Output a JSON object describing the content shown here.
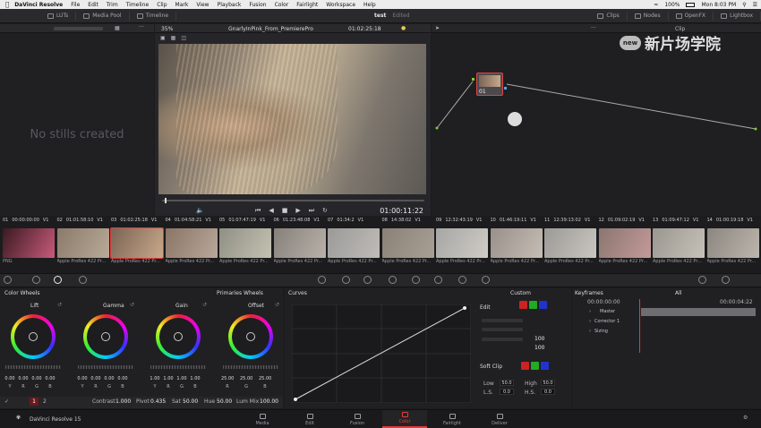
{
  "mac_menu": {
    "app": "DaVinci Resolve",
    "items": [
      "File",
      "Edit",
      "Trim",
      "Timeline",
      "Clip",
      "Mark",
      "View",
      "Playback",
      "Fusion",
      "Color",
      "Fairlight",
      "Workspace",
      "Help"
    ],
    "status": [
      "100%",
      "Mon 8:03 PM"
    ]
  },
  "topbar": {
    "luts": "LUTs",
    "media_pool": "Media Pool",
    "timeline": "Timeline",
    "project": "test",
    "edited": "Edited",
    "clips": "Clips",
    "nodes": "Nodes",
    "openfx": "OpenFX",
    "lightbox": "Lightbox"
  },
  "viewer": {
    "zoom": "35%",
    "clip_name": "GnarlyInPink_From_PremierePro",
    "source_tc": "01:02:25:18",
    "timecode": "01:00:11:22"
  },
  "gallery": {
    "empty_text": "No stills created"
  },
  "nodes": {
    "node_label": "01",
    "clip_header": "Clip"
  },
  "watermark": "新片场学院",
  "clips": [
    {
      "num": "01",
      "tc": "00:00:00:00",
      "track": "V1",
      "codec": "PNG",
      "c1": "#3a1a22",
      "c2": "#c85a7a"
    },
    {
      "num": "02",
      "tc": "01:01:58:10",
      "track": "V1",
      "codec": "Apple ProRes 422 Pr...",
      "c1": "#8a7a6a",
      "c2": "#b9aa98"
    },
    {
      "num": "03",
      "tc": "01:02:25:18",
      "track": "V1",
      "codec": "Apple ProRes 422 Pr...",
      "c1": "#7a6455",
      "c2": "#c8a88a"
    },
    {
      "num": "04",
      "tc": "01:04:58:21",
      "track": "V1",
      "codec": "Apple ProRes 422 Pr...",
      "c1": "#8a7466",
      "c2": "#b9a89a"
    },
    {
      "num": "05",
      "tc": "01:07:47:19",
      "track": "V1",
      "codec": "Apple ProRes 422 Pr...",
      "c1": "#8f8f84",
      "c2": "#c5c2b2"
    },
    {
      "num": "06",
      "tc": "01:23:48:08",
      "track": "V1",
      "codec": "Apple ProRes 422 Pr...",
      "c1": "#86807a",
      "c2": "#b8b2aa"
    },
    {
      "num": "07",
      "tc": "01:34:2",
      "track": "V1",
      "codec": "Apple ProRes 422 Pr...",
      "c1": "#9a9a98",
      "c2": "#c0bcb8"
    },
    {
      "num": "08",
      "tc": "14:38:02",
      "track": "V1",
      "codec": "Apple ProRes 422 Pr...",
      "c1": "#8a8076",
      "c2": "#a8a096"
    },
    {
      "num": "09",
      "tc": "12:32:43:19",
      "track": "V1",
      "codec": "Apple ProRes 422 Pr...",
      "c1": "#a6a6a4",
      "c2": "#d0ccc6"
    },
    {
      "num": "10",
      "tc": "01:46:19:11",
      "track": "V1",
      "codec": "Apple ProRes 422 Pr...",
      "c1": "#98908a",
      "c2": "#c6bdb4"
    },
    {
      "num": "11",
      "tc": "12:39:13:02",
      "track": "V1",
      "codec": "Apple ProRes 422 Pr...",
      "c1": "#9c9a96",
      "c2": "#c9c6c0"
    },
    {
      "num": "12",
      "tc": "01:09:02:19",
      "track": "V1",
      "codec": "Apple ProRes 422 Pr...",
      "c1": "#8a7670",
      "c2": "#c49a9a"
    },
    {
      "num": "13",
      "tc": "01:09:47:12",
      "track": "V1",
      "codec": "Apple ProRes 422 Pr...",
      "c1": "#9a9790",
      "c2": "#c7c1b8"
    },
    {
      "num": "14",
      "tc": "01:00:19:18",
      "track": "V1",
      "codec": "Apple ProRes 422 Pr...",
      "c1": "#8c8680",
      "c2": "#bcb6ae"
    }
  ],
  "color_wheels": {
    "title": "Color Wheels",
    "mode": "Primaries Wheels",
    "wheels": [
      {
        "label": "Lift",
        "values": [
          "0.00",
          "0.00",
          "0.00",
          "0.00"
        ]
      },
      {
        "label": "Gamma",
        "values": [
          "0.00",
          "0.00",
          "0.00",
          "0.00"
        ]
      },
      {
        "label": "Gain",
        "values": [
          "1.00",
          "1.00",
          "1.00",
          "1.00"
        ]
      },
      {
        "label": "Offset",
        "values": [
          "25.00",
          "25.00",
          "25.00"
        ]
      }
    ],
    "channel_labels": [
      "Y",
      "R",
      "G",
      "B"
    ],
    "page1": "1",
    "page2": "2",
    "contrast_label": "Contrast",
    "contrast": "1.000",
    "pivot_label": "Pivot",
    "pivot": "0.435",
    "sat_label": "Sat",
    "sat": "50.00",
    "hue_label": "Hue",
    "hue": "50.00",
    "lummix_label": "Lum Mix",
    "lummix": "100.00"
  },
  "curves": {
    "title": "Curves",
    "custom": "Custom",
    "edit": "Edit",
    "val1": "100",
    "val2": "100"
  },
  "soft_clip": {
    "title": "Soft Clip",
    "low_label": "Low",
    "low": "50.0",
    "high_label": "High",
    "high": "50.0",
    "ls_label": "L.S.",
    "ls": "0.0",
    "hs_label": "H.S.",
    "hs": "0.0"
  },
  "keyframes": {
    "title": "Keyframes",
    "filter": "All",
    "tc_left": "00:00:00:00",
    "tc_right": "00:00:04:22",
    "rows": [
      "Master",
      "Corrector 1",
      "Sizing"
    ]
  },
  "bottom_nav": {
    "brand": "DaVinci Resolve 15",
    "pages": [
      "Media",
      "Edit",
      "Fusion",
      "Color",
      "Fairlight",
      "Deliver"
    ],
    "active": "Color"
  },
  "colors": {
    "accent_red": "#e23c3c",
    "panel": "#202023",
    "bar": "#2a2a2d"
  }
}
